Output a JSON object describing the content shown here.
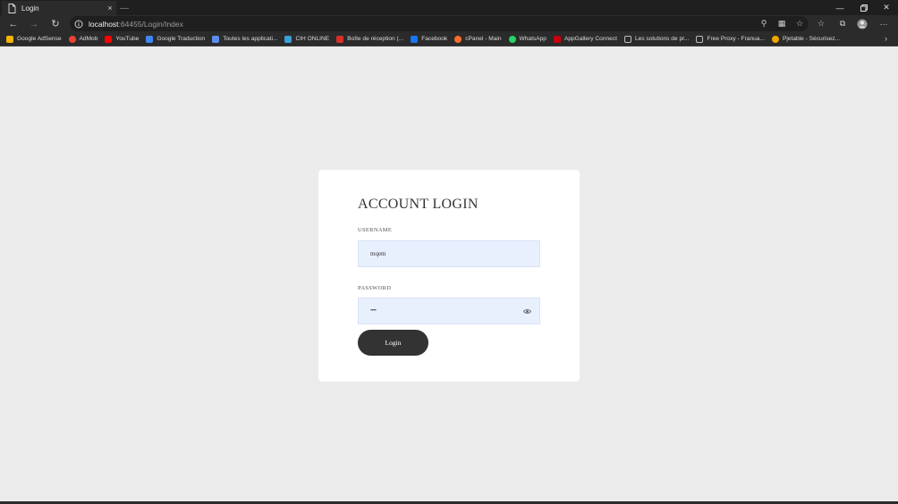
{
  "browser": {
    "tab_title": "Login",
    "tab_close": "×",
    "url_host": "localhost",
    "url_rest": ":64455/Login/Index",
    "bookmarks": [
      {
        "label": "Google AdSense",
        "color": "#f4b400"
      },
      {
        "label": "AdMob",
        "color": "#ea4335"
      },
      {
        "label": "YouTube",
        "color": "#ff0000"
      },
      {
        "label": "Google Traduction",
        "color": "#4285f4"
      },
      {
        "label": "Toutes les applicati...",
        "color": "#5b8def"
      },
      {
        "label": "CIH ONLINE",
        "color": "#3aa0d8"
      },
      {
        "label": "Boîte de réception (...",
        "color": "#d93025"
      },
      {
        "label": "Facebook",
        "color": "#1877f2"
      },
      {
        "label": "cPanel - Main",
        "color": "#ff6c2c"
      },
      {
        "label": "WhatsApp",
        "color": "#25d366"
      },
      {
        "label": "AppGallery Connect",
        "color": "#c7000b"
      },
      {
        "label": "Les solutions de pr...",
        "color": "#9e9e9e"
      },
      {
        "label": "Free Proxy - Franua...",
        "color": "#9e9e9e"
      },
      {
        "label": "Pjetable - Sécurisez...",
        "color": "#f0a500"
      }
    ],
    "more_label": "›"
  },
  "login": {
    "title": "ACCOUNT LOGIN",
    "username_label": "USERNAME",
    "username_value": "mqem",
    "password_label": "PASSWORD",
    "password_value": "••••",
    "button_label": "Login"
  }
}
